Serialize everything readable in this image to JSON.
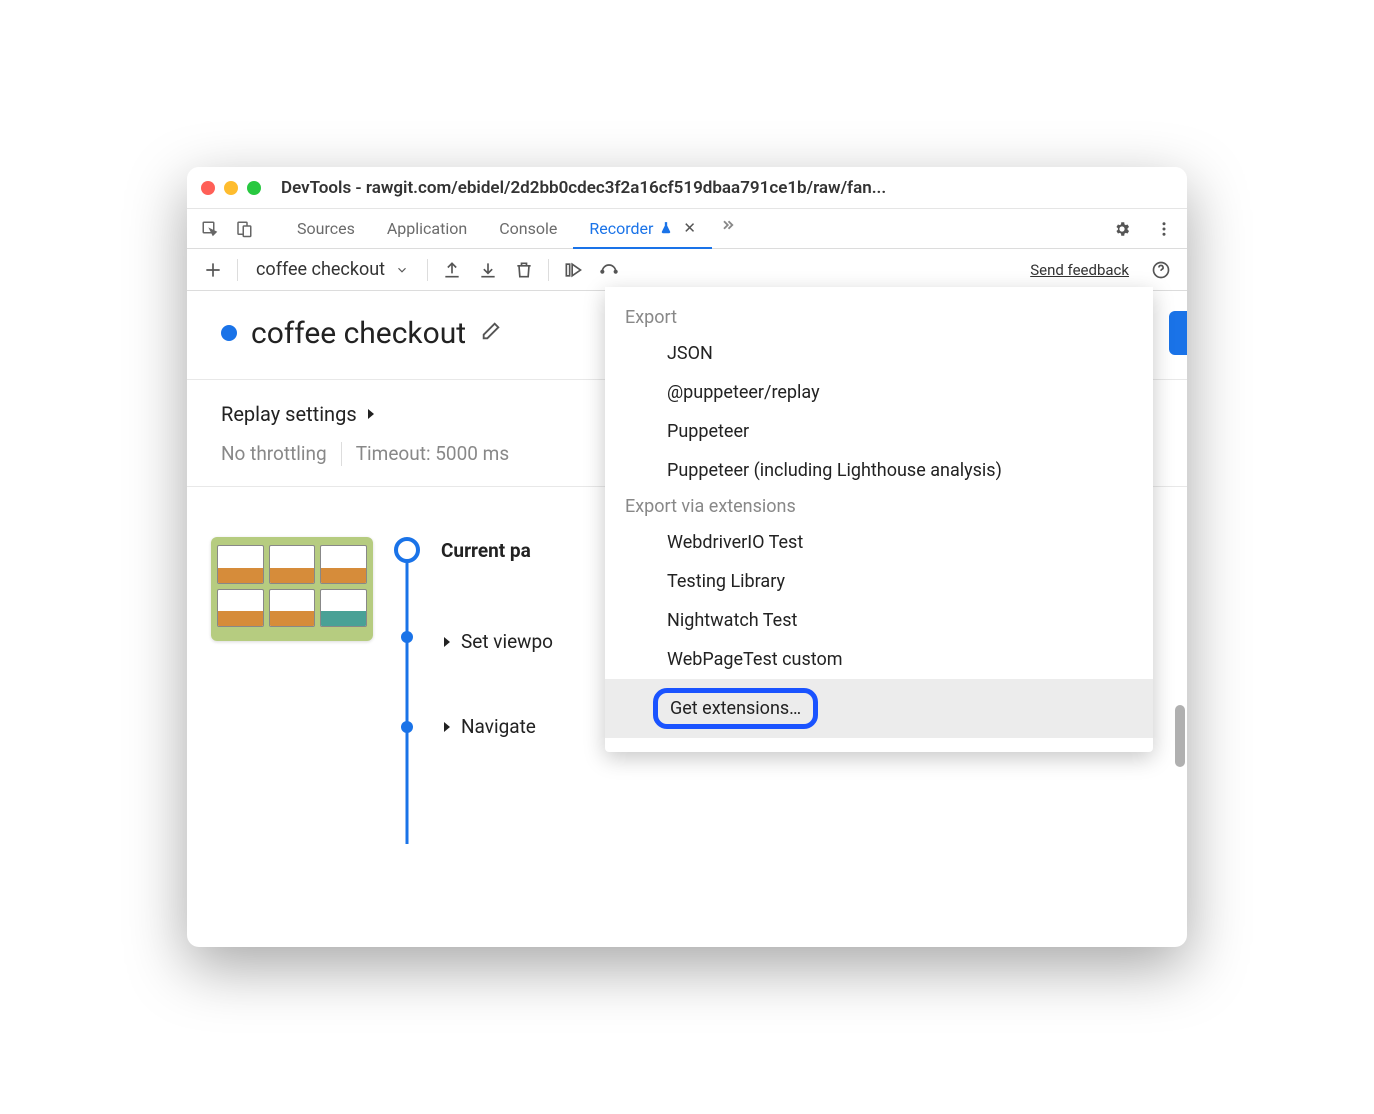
{
  "window": {
    "title": "DevTools - rawgit.com/ebidel/2d2bb0cdec3f2a16cf519dbaa791ce1b/raw/fan..."
  },
  "tabs": {
    "items": [
      "Sources",
      "Application",
      "Console"
    ],
    "active": "Recorder"
  },
  "toolbar": {
    "recording_name": "coffee checkout",
    "feedback": "Send feedback"
  },
  "recording": {
    "title": "coffee checkout"
  },
  "replay": {
    "heading": "Replay settings",
    "throttling": "No throttling",
    "timeout": "Timeout: 5000 ms"
  },
  "steps": {
    "current": "Current pa",
    "items": [
      "Set viewpo",
      "Navigate"
    ]
  },
  "export_menu": {
    "section1": "Export",
    "options1": [
      "JSON",
      "@puppeteer/replay",
      "Puppeteer",
      "Puppeteer (including Lighthouse analysis)"
    ],
    "section2": "Export via extensions",
    "options2": [
      "WebdriverIO Test",
      "Testing Library",
      "Nightwatch Test",
      "WebPageTest custom"
    ],
    "get_extensions": "Get extensions…"
  }
}
